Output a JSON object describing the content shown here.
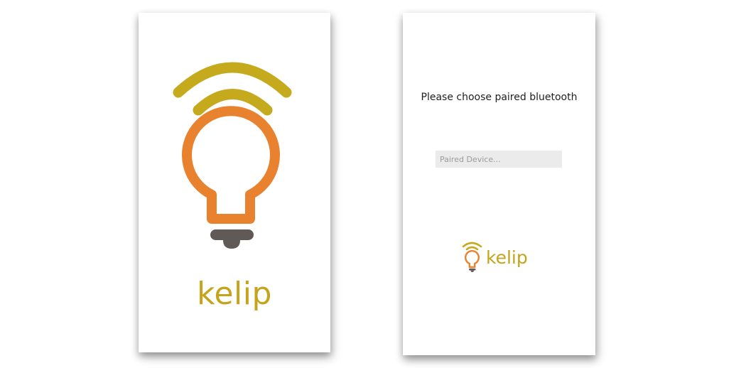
{
  "splash": {
    "brand": "kelip",
    "logo_icon": "bulb-wifi-icon"
  },
  "pairing": {
    "prompt": "Please choose paired bluetooth",
    "device_field": {
      "placeholder": "Paired Device...",
      "value": ""
    },
    "brand": "kelip",
    "logo_icon": "bulb-wifi-icon"
  },
  "colors": {
    "signal": "#c5aa1e",
    "bulb": "#e8822f",
    "base": "#605955",
    "brand_text": "#c5a41c"
  }
}
